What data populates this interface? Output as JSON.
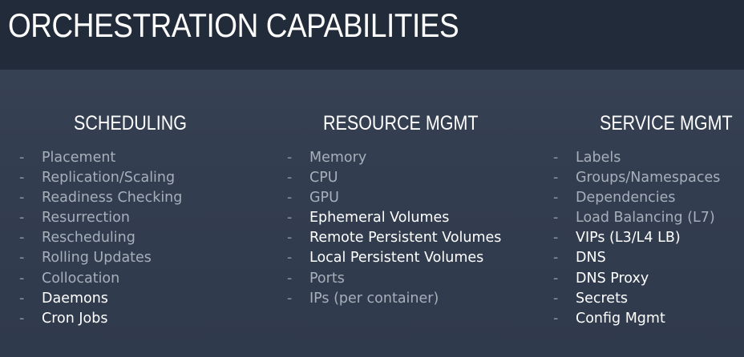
{
  "title": "ORCHESTRATION CAPABILITIES",
  "columns": [
    {
      "heading": "SCHEDULING",
      "items": [
        {
          "dash": "-",
          "label": "Placement",
          "style": "muted"
        },
        {
          "dash": "-",
          "label": "Replication/Scaling",
          "style": "muted"
        },
        {
          "dash": "-",
          "label": "Readiness Checking",
          "style": "muted"
        },
        {
          "dash": "-",
          "label": "Resurrection",
          "style": "muted"
        },
        {
          "dash": "-",
          "label": "Rescheduling",
          "style": "muted"
        },
        {
          "dash": "-",
          "label": "Rolling Updates",
          "style": "muted"
        },
        {
          "dash": "-",
          "label": "Collocation",
          "style": "muted"
        },
        {
          "dash": "-",
          "label": "Daemons",
          "style": "bright"
        },
        {
          "dash": "-",
          "label": "Cron Jobs",
          "style": "bright"
        }
      ]
    },
    {
      "heading": "RESOURCE MGMT",
      "items": [
        {
          "dash": "-",
          "label": "Memory",
          "style": "muted"
        },
        {
          "dash": "-",
          "label": "CPU",
          "style": "muted"
        },
        {
          "dash": "-",
          "label": "GPU",
          "style": "muted"
        },
        {
          "dash": "-",
          "label": "Ephemeral Volumes",
          "style": "bright"
        },
        {
          "dash": "-",
          "label": "Remote Persistent Volumes",
          "style": "bright"
        },
        {
          "dash": "-",
          "label": "Local Persistent Volumes",
          "style": "bright"
        },
        {
          "dash": "-",
          "label": "Ports",
          "style": "muted"
        },
        {
          "dash": "-",
          "label": "IPs (per container)",
          "style": "muted"
        }
      ]
    },
    {
      "heading": "SERVICE MGMT",
      "items": [
        {
          "dash": "-",
          "label": "Labels",
          "style": "muted"
        },
        {
          "dash": "-",
          "label": "Groups/Namespaces",
          "style": "muted"
        },
        {
          "dash": "-",
          "label": "Dependencies",
          "style": "muted"
        },
        {
          "dash": "-",
          "label": "Load Balancing (L7)",
          "style": "muted"
        },
        {
          "dash": "-",
          "label": "VIPs (L3/L4 LB)",
          "style": "bright"
        },
        {
          "dash": "-",
          "label": "DNS",
          "style": "bright"
        },
        {
          "dash": "-",
          "label": "DNS Proxy",
          "style": "bright"
        },
        {
          "dash": "-",
          "label": "Secrets",
          "style": "bright"
        },
        {
          "dash": "-",
          "label": "Config Mgmt",
          "style": "bright"
        }
      ]
    }
  ],
  "colors": {
    "title_bar": "#222b39",
    "background": "#333e50",
    "text_bright": "#ffffff",
    "text_muted": "#a7afbb",
    "dash": "#8f98a6"
  }
}
